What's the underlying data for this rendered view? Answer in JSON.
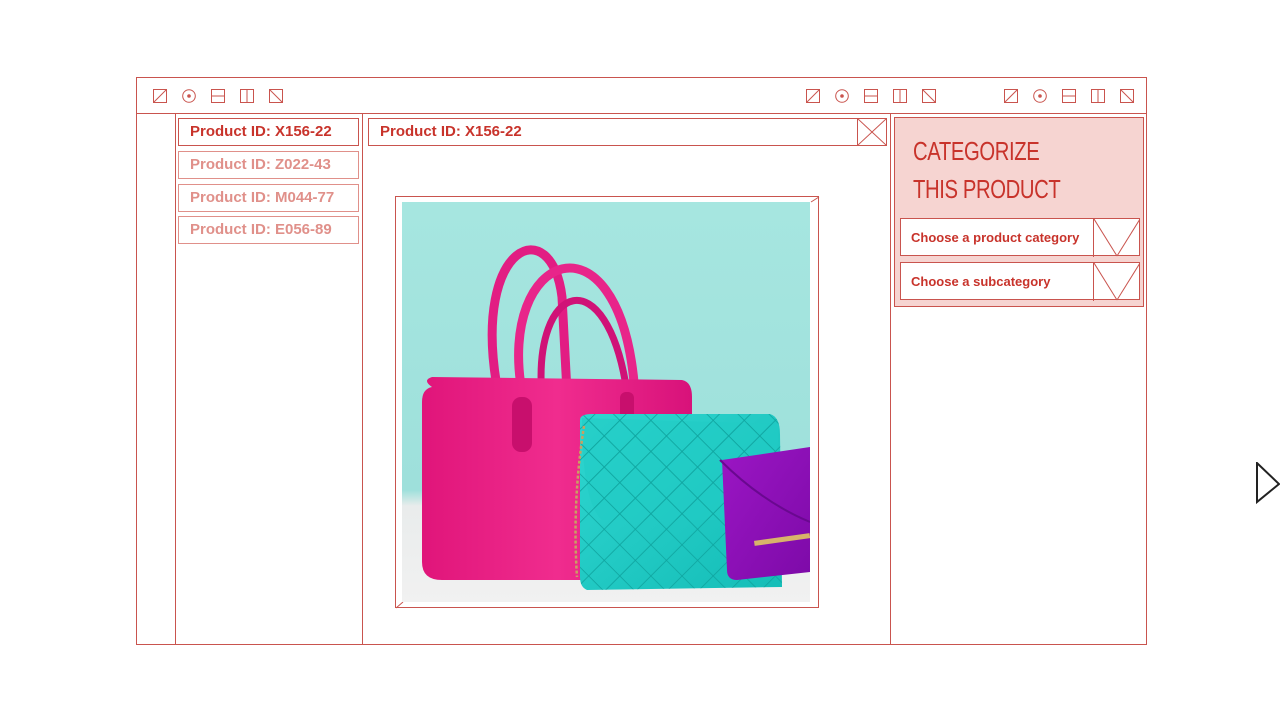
{
  "product_list": [
    {
      "label": "Product ID: X156-22",
      "active": true
    },
    {
      "label": "Product ID: Z022-43",
      "active": false
    },
    {
      "label": "Product ID: M044-77",
      "active": false
    },
    {
      "label": "Product ID: E056-89",
      "active": false
    }
  ],
  "detail": {
    "title": "Product ID: X156-22"
  },
  "categorize": {
    "title_line1": "CATEGORIZE",
    "title_line2": "THIS PRODUCT",
    "category_placeholder": "Choose a product category",
    "subcategory_placeholder": "Choose a subcategory"
  },
  "toolbar_icons": [
    "diagonal-box-icon",
    "target-icon",
    "horizontal-split-icon",
    "vertical-split-icon",
    "back-diagonal-box-icon"
  ],
  "colors": {
    "accent": "#c8332b",
    "line": "#c9544e",
    "panel_bg": "#f6d4d1",
    "faded": "#e0908a"
  }
}
